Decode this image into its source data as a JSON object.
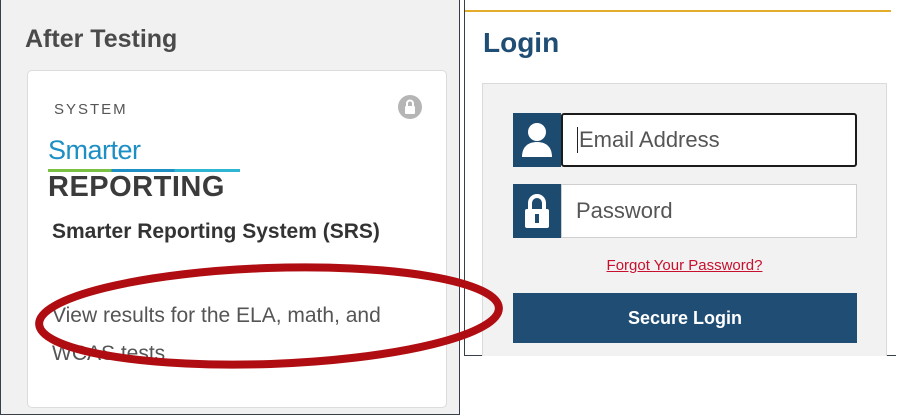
{
  "after_testing": {
    "heading": "After Testing",
    "card": {
      "category": "SYSTEM",
      "lock_icon": "lock-icon",
      "logo": {
        "top": "Smarter",
        "bottom": "REPORTING"
      },
      "title": "Smarter Reporting System (SRS)",
      "description": "View results for the ELA, math, and WCAS tests"
    }
  },
  "login": {
    "heading": "Login",
    "email": {
      "icon": "user-icon",
      "placeholder": "Email Address",
      "value": ""
    },
    "password": {
      "icon": "lock-icon",
      "placeholder": "Password",
      "value": ""
    },
    "forgot_link": "Forgot Your Password?",
    "submit_label": "Secure Login"
  },
  "colors": {
    "brand_navy": "#1f4d74",
    "accent_gold": "#e3ad2b",
    "link_red": "#c8102e",
    "annotation_red": "#b00d12",
    "logo_blue": "#1d8fc4",
    "logo_green": "#7ac143"
  }
}
